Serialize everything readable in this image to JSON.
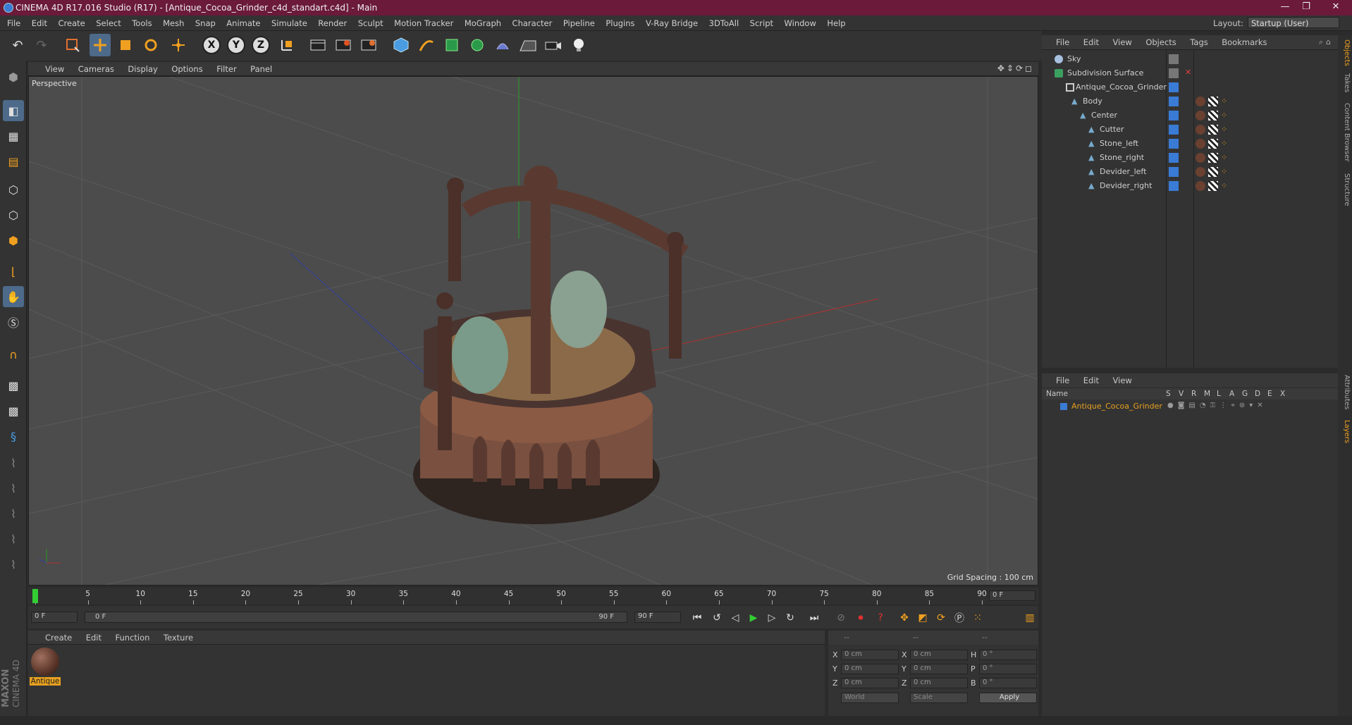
{
  "window": {
    "title": "CINEMA 4D R17.016 Studio (R17) - [Antique_Cocoa_Grinder_c4d_standart.c4d] - Main",
    "minimize": "—",
    "maximize": "❐",
    "close": "✕"
  },
  "menu": [
    "File",
    "Edit",
    "Create",
    "Select",
    "Tools",
    "Mesh",
    "Snap",
    "Animate",
    "Simulate",
    "Render",
    "Sculpt",
    "Motion Tracker",
    "MoGraph",
    "Character",
    "Pipeline",
    "Plugins",
    "V-Ray Bridge",
    "3DToAll",
    "Script",
    "Window",
    "Help"
  ],
  "layout": {
    "label": "Layout:",
    "value": "Startup (User)"
  },
  "toolbar": {
    "axis_x": "X",
    "axis_y": "Y",
    "axis_z": "Z"
  },
  "viewport": {
    "menu": [
      "View",
      "Cameras",
      "Display",
      "Options",
      "Filter",
      "Panel"
    ],
    "camera_label": "Perspective",
    "grid_spacing": "Grid Spacing : 100 cm"
  },
  "timeline": {
    "ticks": [
      "0",
      "5",
      "10",
      "15",
      "20",
      "25",
      "30",
      "35",
      "40",
      "45",
      "50",
      "55",
      "60",
      "65",
      "70",
      "75",
      "80",
      "85",
      "90"
    ],
    "current_frame": "0 F"
  },
  "transport": {
    "start": "0 F",
    "range_start": "0 F",
    "range_end": "90 F",
    "end": "90 F"
  },
  "material_manager": {
    "menu": [
      "Create",
      "Edit",
      "Function",
      "Texture"
    ],
    "materials": [
      {
        "name": "Antique"
      }
    ]
  },
  "coordinates": {
    "head_left": "--",
    "head_mid": "--",
    "head_right": "--",
    "rows": [
      {
        "axis": "X",
        "pos": "0 cm",
        "axis2": "X",
        "size": "0 cm",
        "axis3": "H",
        "rot": "0 °"
      },
      {
        "axis": "Y",
        "pos": "0 cm",
        "axis2": "Y",
        "size": "0 cm",
        "axis3": "P",
        "rot": "0 °"
      },
      {
        "axis": "Z",
        "pos": "0 cm",
        "axis2": "Z",
        "size": "0 cm",
        "axis3": "B",
        "rot": "0 °"
      }
    ],
    "mode": "World",
    "scale": "Scale",
    "apply": "Apply"
  },
  "object_manager": {
    "menu": [
      "File",
      "Edit",
      "View",
      "Objects",
      "Tags",
      "Bookmarks"
    ],
    "objects": [
      {
        "name": "Sky"
      },
      {
        "name": "Subdivision Surface"
      },
      {
        "name": "Antique_Cocoa_Grinder"
      },
      {
        "name": "Body"
      },
      {
        "name": "Center"
      },
      {
        "name": "Cutter"
      },
      {
        "name": "Stone_left"
      },
      {
        "name": "Stone_right"
      },
      {
        "name": "Devider_left"
      },
      {
        "name": "Devider_right"
      }
    ]
  },
  "layer_manager": {
    "menu": [
      "File",
      "Edit",
      "View"
    ],
    "columns": [
      "Name",
      "S",
      "V",
      "R",
      "M",
      "L",
      "A",
      "G",
      "D",
      "E",
      "X"
    ],
    "layers": [
      {
        "name": "Antique_Cocoa_Grinder",
        "color": "#3a7bd5"
      }
    ]
  },
  "right_tabs": [
    "Objects",
    "Takes",
    "Content Browser",
    "Structure",
    "Attributes",
    "Layers"
  ],
  "logo": {
    "line1": "MAXON",
    "line2": "CINEMA 4D"
  },
  "colors": {
    "title_bar": "#6b1a3a",
    "accent": "#4d6a8a",
    "material_label": "#e6a020",
    "layer_name": "#e6a020"
  }
}
